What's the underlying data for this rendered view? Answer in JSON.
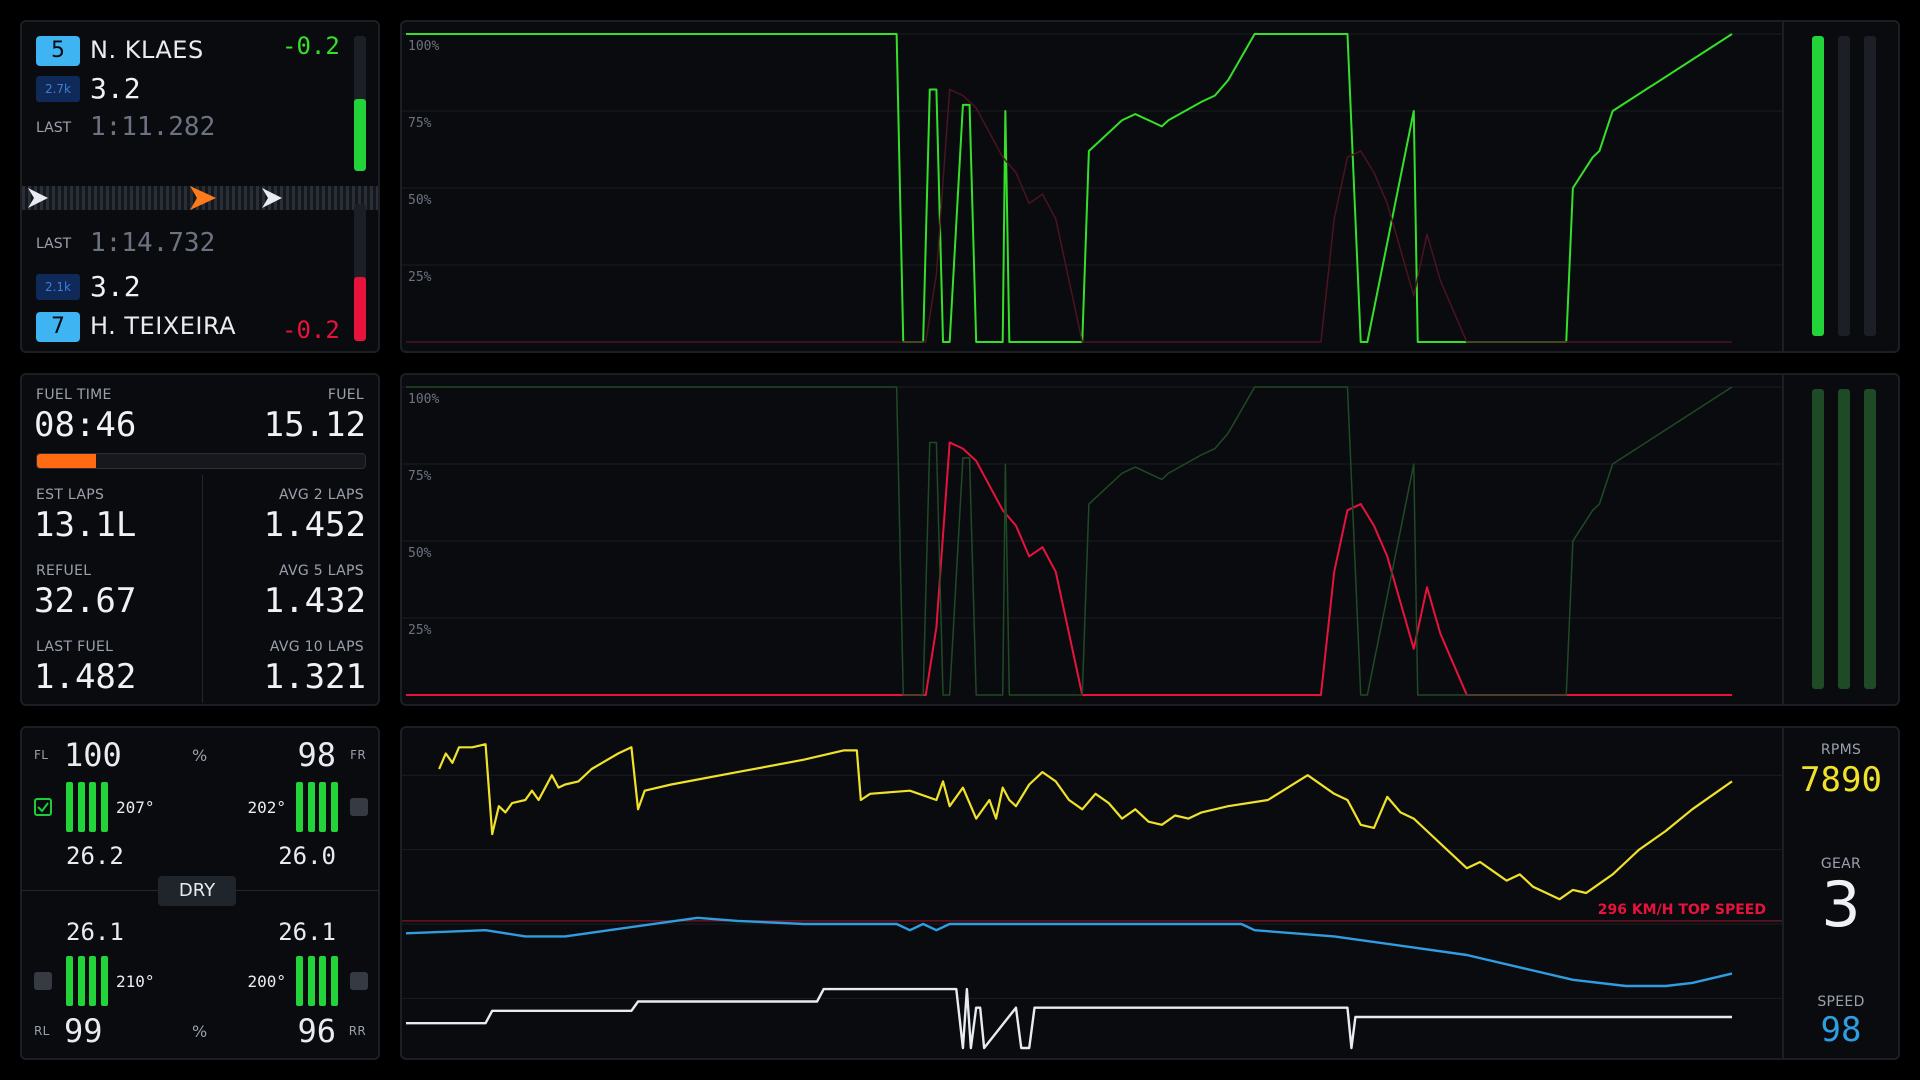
{
  "drivers": {
    "ahead": {
      "position": "5",
      "name": "N. KLAES",
      "gap": "-0.2",
      "irating": "2.7k",
      "rating": "3.2",
      "last_label": "LAST",
      "last_time": "1:11.282"
    },
    "behind": {
      "position": "7",
      "name": "H. TEIXEIRA",
      "gap": "-0.2",
      "irating": "2.1k",
      "rating": "3.2",
      "last_label": "LAST",
      "last_time": "1:14.732"
    }
  },
  "fuel": {
    "fuel_time_label": "FUEL TIME",
    "fuel_time": "08:46",
    "fuel_label": "FUEL",
    "fuel": "15.12",
    "level": 0.18,
    "est_laps_label": "EST LAPS",
    "est_laps": "13.1L",
    "avg2_label": "AVG 2 LAPS",
    "avg2": "1.452",
    "refuel_label": "REFUEL",
    "refuel": "32.67",
    "avg5_label": "AVG 5 LAPS",
    "avg5": "1.432",
    "last_fuel_label": "LAST FUEL",
    "last_fuel": "1.482",
    "avg10_label": "AVG 10 LAPS",
    "avg10": "1.321"
  },
  "tyres": {
    "fl_label": "FL",
    "fl_wear": "100",
    "fl_temp": "207°",
    "fl_pressure": "26.2",
    "fr_label": "FR",
    "fr_wear": "98",
    "fr_temp": "202°",
    "fr_pressure": "26.0",
    "rl_label": "RL",
    "rl_wear": "99",
    "rl_temp": "210°",
    "rl_pressure": "26.1",
    "rr_label": "RR",
    "rr_wear": "96",
    "rr_temp": "200°",
    "rr_pressure": "26.1",
    "pct_top": "%",
    "pct_bottom": "%",
    "compound": "DRY"
  },
  "telemetry": {
    "rpm_label": "RPMS",
    "rpm": "7890",
    "gear_label": "GEAR",
    "gear": "3",
    "speed_label": "SPEED",
    "speed": "98",
    "top_speed": "296 KM/H TOP SPEED"
  },
  "colors": {
    "throttle": "#34e02a",
    "brake": "#e8133c",
    "rpm": "#f0e22a",
    "speed": "#2f9de0",
    "gear": "#e8ecf2",
    "accent_orange": "#ff6a13",
    "badge_blue": "#3fb4f3"
  },
  "icons": {
    "car_ahead": "chevron-right-icon",
    "player": "chevron-right-icon",
    "car_behind": "chevron-right-icon",
    "tyre": "tyre-icon",
    "checkbox": "checkbox-icon"
  },
  "chart_data": [
    {
      "type": "line",
      "name_hint": "inputs-throttle",
      "yticks": [
        "100%",
        "75%",
        "50%",
        "25%"
      ],
      "ylim": [
        0,
        100
      ],
      "xlim": [
        0,
        100
      ],
      "series": [
        {
          "x": [
            0,
            37,
            37.5,
            39,
            39.5,
            40,
            40.5,
            41,
            42,
            42.5,
            43,
            45,
            45.2,
            45.5,
            51,
            51.5,
            54,
            55,
            57,
            57.5,
            60,
            61,
            62,
            64,
            66,
            67,
            69,
            71,
            72,
            72.5,
            76,
            76.3,
            76.6,
            80,
            81,
            82,
            83,
            84,
            85,
            86,
            87.5,
            88,
            89.5,
            90,
            91,
            100
          ],
          "y": [
            100,
            100,
            0,
            0,
            82,
            82,
            0,
            0,
            77,
            77,
            0,
            0,
            75,
            0,
            0,
            62,
            72,
            74,
            70,
            72,
            78,
            80,
            85,
            100,
            100,
            100,
            100,
            100,
            0,
            0,
            75,
            0,
            0,
            0,
            0,
            0,
            0,
            0,
            0,
            0,
            0,
            50,
            60,
            62,
            75,
            100
          ]
        },
        {
          "x": [
            0,
            39.2,
            40,
            41,
            42,
            43,
            45,
            46,
            47,
            48,
            49,
            51,
            68,
            69,
            70,
            71,
            72,
            73,
            74,
            75,
            76,
            77,
            78,
            79,
            80,
            81,
            82,
            83,
            84,
            85,
            86,
            100
          ],
          "y": [
            0,
            0,
            22,
            82,
            80,
            76,
            60,
            55,
            45,
            48,
            40,
            0,
            0,
            0,
            40,
            60,
            62,
            55,
            45,
            30,
            15,
            35,
            20,
            10,
            0,
            0,
            0,
            0,
            0,
            0,
            0,
            0
          ]
        }
      ]
    },
    {
      "type": "line",
      "name_hint": "inputs-brake",
      "yticks": [
        "100%",
        "75%",
        "50%",
        "25%"
      ],
      "ylim": [
        0,
        100
      ],
      "xlim": [
        0,
        100
      ],
      "series": [
        {
          "x": [
            0,
            39.2,
            40,
            41,
            42,
            43,
            45,
            46,
            47,
            48,
            49,
            51,
            68,
            69,
            70,
            71,
            72,
            73,
            74,
            75,
            76,
            77,
            78,
            79,
            80,
            81,
            82,
            83,
            84,
            85,
            86,
            100
          ],
          "y": [
            0,
            0,
            22,
            82,
            80,
            76,
            60,
            55,
            45,
            48,
            40,
            0,
            0,
            0,
            40,
            60,
            62,
            55,
            45,
            30,
            15,
            35,
            20,
            10,
            0,
            0,
            0,
            0,
            0,
            0,
            0,
            0
          ]
        },
        {
          "x": [
            0,
            37,
            37.5,
            39,
            39.5,
            40,
            40.5,
            41,
            42,
            42.5,
            43,
            45,
            45.2,
            45.5,
            51,
            51.5,
            54,
            55,
            57,
            57.5,
            60,
            61,
            62,
            64,
            66,
            67,
            69,
            71,
            72,
            72.5,
            76,
            76.3,
            76.6,
            80,
            81,
            82,
            83,
            84,
            85,
            86,
            87.5,
            88,
            89.5,
            90,
            91,
            100
          ],
          "y": [
            100,
            100,
            0,
            0,
            82,
            82,
            0,
            0,
            77,
            77,
            0,
            0,
            75,
            0,
            0,
            62,
            72,
            74,
            70,
            72,
            78,
            80,
            85,
            100,
            100,
            100,
            100,
            100,
            0,
            0,
            75,
            0,
            0,
            0,
            0,
            0,
            0,
            0,
            0,
            0,
            0,
            50,
            60,
            62,
            75,
            100
          ]
        }
      ]
    },
    {
      "type": "line",
      "name_hint": "rpm-speed-gear",
      "ylim": [
        0,
        100
      ],
      "xlim": [
        0,
        100
      ],
      "top_speed_line": 41,
      "series": [
        {
          "name": "RPMS",
          "x": [
            2.5,
            3,
            3.5,
            4,
            5,
            6,
            6.5,
            7,
            7.5,
            8,
            9,
            9.5,
            10,
            11,
            11.5,
            12,
            13,
            14,
            16,
            17,
            17.5,
            18,
            20,
            25,
            30,
            33,
            34,
            34.3,
            35,
            38,
            40,
            40.5,
            41,
            42,
            43,
            44,
            44.5,
            45,
            45.5,
            46,
            47,
            48,
            49,
            50,
            51,
            52,
            53,
            54,
            55,
            56,
            57,
            58,
            59,
            60,
            62,
            65,
            68,
            70,
            71,
            72,
            73,
            74,
            75,
            76,
            77,
            78,
            79,
            80,
            81,
            82,
            83,
            84,
            85,
            86,
            87,
            88,
            89,
            90,
            91,
            92,
            93,
            95,
            97,
            99,
            100
          ],
          "y": [
            90,
            95,
            92,
            97,
            97,
            98,
            69,
            78,
            76,
            79,
            80,
            83,
            80,
            88,
            84,
            85,
            86,
            90,
            95,
            97,
            77,
            83,
            85,
            89,
            93,
            96,
            96,
            80,
            82,
            83,
            80,
            86,
            78,
            84,
            74,
            80,
            74,
            84,
            80,
            78,
            85,
            89,
            86,
            80,
            77,
            82,
            79,
            74,
            77,
            73,
            72,
            75,
            74,
            76,
            78,
            80,
            88,
            82,
            80,
            72,
            71,
            81,
            76,
            74,
            70,
            66,
            62,
            58,
            60,
            57,
            54,
            56,
            52,
            50,
            48,
            51,
            50,
            53,
            56,
            60,
            64,
            70,
            77,
            83,
            86
          ]
        },
        {
          "name": "SPEED",
          "x": [
            0,
            6,
            9,
            12,
            17,
            22,
            25,
            30,
            35,
            37,
            38,
            39,
            40,
            41,
            50,
            52,
            53,
            62,
            63,
            64,
            70,
            80,
            85,
            88,
            92,
            95,
            97,
            100
          ],
          "y": [
            37,
            38,
            36,
            36,
            39,
            42,
            41,
            40,
            40,
            40,
            38,
            40,
            38,
            40,
            40,
            40,
            40,
            40,
            40,
            38,
            36,
            30,
            25,
            22,
            20,
            20,
            21,
            24
          ]
        },
        {
          "name": "GEAR",
          "x": [
            0,
            6,
            6.5,
            17,
            17.5,
            31,
            31.5,
            41.5,
            42,
            42.3,
            42.6,
            43,
            43.3,
            43.6,
            46,
            46.4,
            47,
            47.4,
            71,
            71.3,
            71.6,
            100
          ],
          "y": [
            8,
            8,
            12,
            12,
            15,
            15,
            19,
            19,
            0,
            19,
            0,
            13,
            13,
            0,
            13,
            0,
            0,
            13,
            13,
            0,
            10,
            10
          ]
        }
      ]
    }
  ]
}
